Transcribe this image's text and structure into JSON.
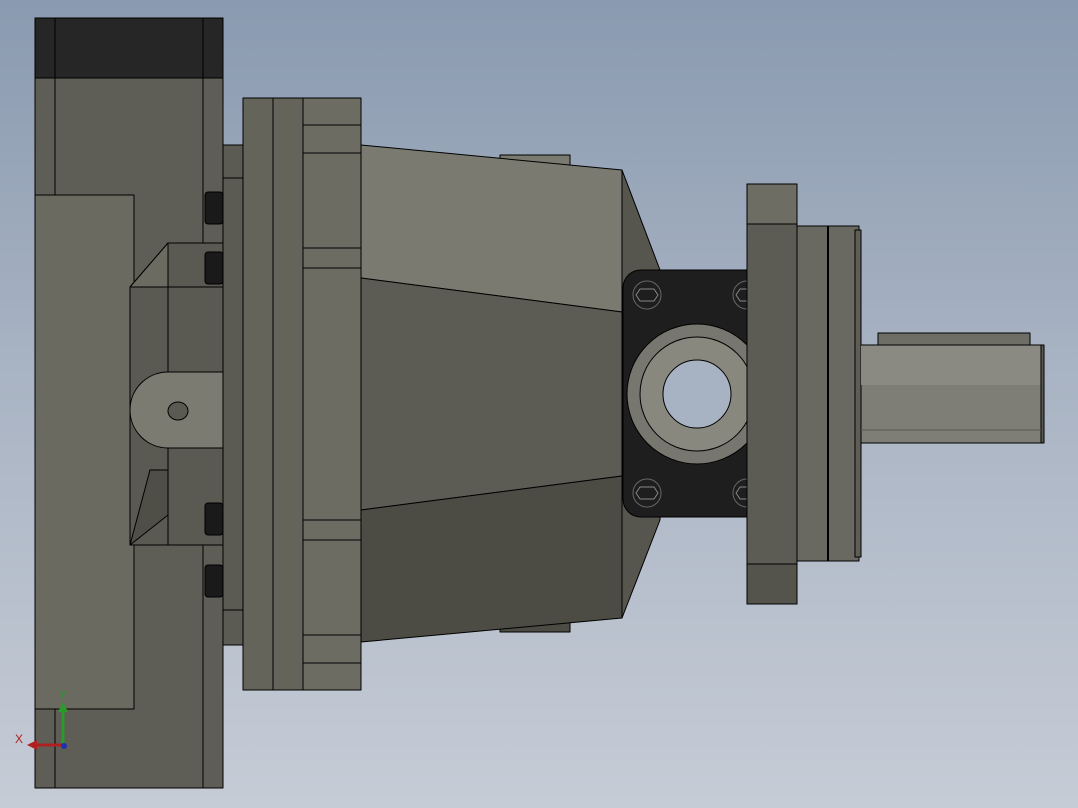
{
  "viewport": {
    "background_top": "#8a9ab0",
    "background_bottom": "#c6ccd6"
  },
  "model": {
    "description_icon": "hydraulic-pump-model",
    "body_color_light": "#7a7a70",
    "body_color_mid": "#5f5e56",
    "body_color_dark": "#4c4b44",
    "port_flange_color": "#1e1e1e",
    "edge_color": "#000000"
  },
  "triad": {
    "x_label": "X",
    "y_label": "Y",
    "x_color": "#b02020",
    "y_color": "#2a9a2a",
    "z_color": "#2030b0"
  }
}
